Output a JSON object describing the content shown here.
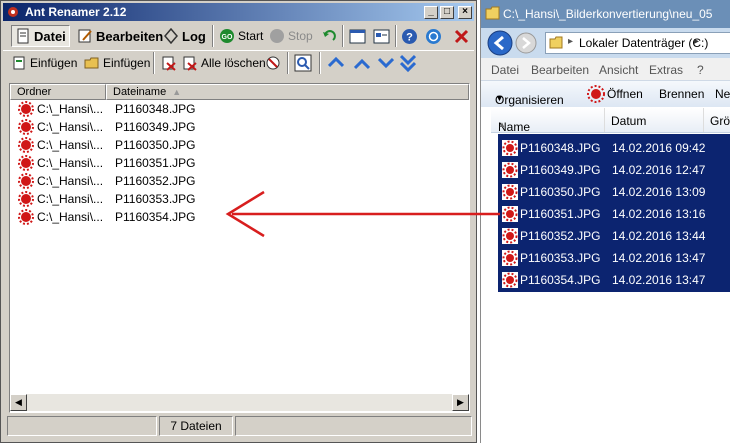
{
  "left_window": {
    "title": "Ant Renamer 2.12",
    "tabs": [
      {
        "label": "Datei",
        "icon": "file-icon",
        "active": true
      },
      {
        "label": "Bearbeiten",
        "icon": "edit-icon"
      },
      {
        "label": "Log",
        "icon": "log-icon"
      }
    ],
    "start_label": "Start",
    "stop_label": "Stop",
    "toolbar2": {
      "add_files_label": "Einfügen",
      "add_folders_label": "Einfügen",
      "delete_all_label": "Alle löschen"
    },
    "columns": {
      "folder": "Ordner",
      "filename": "Dateiname"
    },
    "rows": [
      {
        "folder": "C:\\_Hansi\\...",
        "filename": "P1160348.JPG"
      },
      {
        "folder": "C:\\_Hansi\\...",
        "filename": "P1160349.JPG"
      },
      {
        "folder": "C:\\_Hansi\\...",
        "filename": "P1160350.JPG"
      },
      {
        "folder": "C:\\_Hansi\\...",
        "filename": "P1160351.JPG"
      },
      {
        "folder": "C:\\_Hansi\\...",
        "filename": "P1160352.JPG"
      },
      {
        "folder": "C:\\_Hansi\\...",
        "filename": "P1160353.JPG"
      },
      {
        "folder": "C:\\_Hansi\\...",
        "filename": "P1160354.JPG"
      }
    ],
    "status_count": "7 Dateien"
  },
  "right_window": {
    "title": "C:\\_Hansi\\_Bilderkonvertierung\\neu_05",
    "address": "Lokaler Datenträger (C:)",
    "menu": [
      "Datei",
      "Bearbeiten",
      "Ansicht",
      "Extras",
      "?"
    ],
    "commands": {
      "organize": "Organisieren",
      "open": "Öffnen",
      "burn": "Brennen",
      "new_partial": "Ne"
    },
    "columns": {
      "name": "Name",
      "date": "Datum",
      "size_partial": "Größ"
    },
    "rows": [
      {
        "name": "P1160348.JPG",
        "date": "14.02.2016 09:42"
      },
      {
        "name": "P1160349.JPG",
        "date": "14.02.2016 12:47"
      },
      {
        "name": "P1160350.JPG",
        "date": "14.02.2016 13:09"
      },
      {
        "name": "P1160351.JPG",
        "date": "14.02.2016 13:16"
      },
      {
        "name": "P1160352.JPG",
        "date": "14.02.2016 13:44"
      },
      {
        "name": "P1160353.JPG",
        "date": "14.02.2016 13:47"
      },
      {
        "name": "P1160354.JPG",
        "date": "14.02.2016 13:47"
      }
    ],
    "selection_color": "#0c2470"
  },
  "annotation": {
    "arrow_color": "#d81e1e",
    "direction": "right-to-left"
  }
}
